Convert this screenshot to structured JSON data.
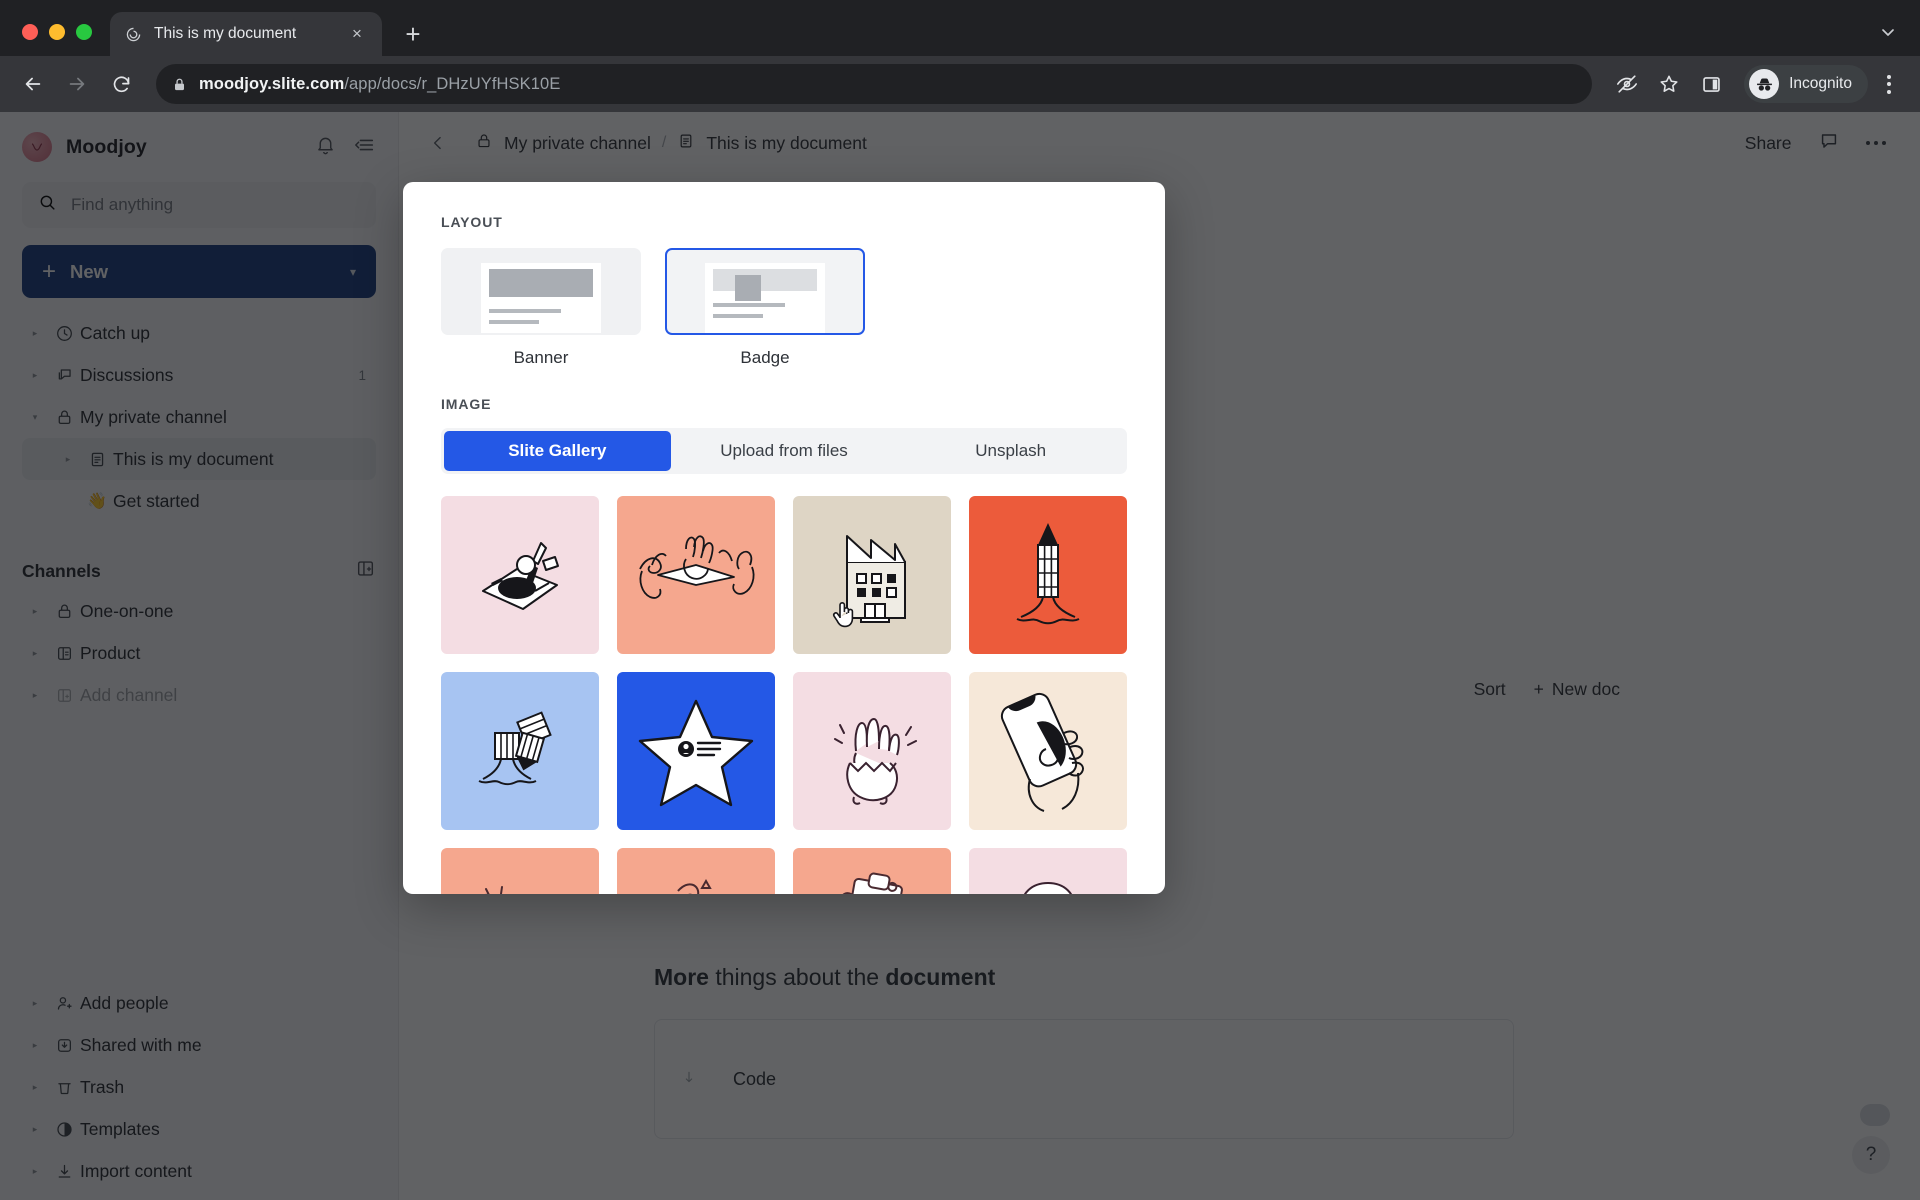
{
  "browser": {
    "tab": {
      "title": "This is my document",
      "favicon": "slite-icon",
      "close": "×"
    },
    "new_tab": "+",
    "tabstrip_chevron": "chevron-down-icon",
    "url_bold": "moodjoy.slite.com",
    "url_rest": "/app/docs/r_DHzUYfHSK10E",
    "lock": "lock-icon",
    "back": "back-arrow-icon",
    "forward": "forward-arrow-icon",
    "reload": "reload-icon",
    "icons": {
      "tracking": "eye-off-icon",
      "bookmark": "star-icon",
      "sidepanel": "side-panel-icon"
    },
    "profile_label": "Incognito",
    "menu": "kebab-menu-icon"
  },
  "sidebar": {
    "workspace": "Moodjoy",
    "notifications_icon": "bell-icon",
    "collapse_icon": "collapse-sidebar-icon",
    "search_placeholder": "Find anything",
    "new_button": {
      "label": "New",
      "plus": "+",
      "caret": "▾"
    },
    "nav": [
      {
        "label": "Catch up",
        "icon": "clock-icon",
        "badge": "",
        "indent": false,
        "selected": false,
        "ghost": false
      },
      {
        "label": "Discussions",
        "icon": "chat-icon",
        "badge": "1",
        "indent": false,
        "selected": false,
        "ghost": false
      },
      {
        "label": "My private channel",
        "icon": "lock-icon",
        "badge": "",
        "indent": false,
        "selected": false,
        "ghost": false,
        "expanded": true
      },
      {
        "label": "This is my document",
        "icon": "doc-icon",
        "badge": "",
        "indent": true,
        "selected": true,
        "ghost": false
      },
      {
        "label": "Get started",
        "icon": "wave-emoji",
        "badge": "",
        "indent": true,
        "selected": false,
        "ghost": false
      }
    ],
    "channels_title": "Channels",
    "channels_action_icon": "add-channel-icon",
    "channels": [
      {
        "label": "One-on-one",
        "icon": "lock-icon",
        "ghost": false
      },
      {
        "label": "Product",
        "icon": "channel-icon",
        "ghost": false
      },
      {
        "label": "Add channel",
        "icon": "add-channel-icon",
        "ghost": true
      }
    ],
    "bottom": [
      {
        "label": "Add people",
        "icon": "add-person-icon",
        "ghost": false
      },
      {
        "label": "Shared with me",
        "icon": "shared-inbox-icon",
        "ghost": false
      },
      {
        "label": "Trash",
        "icon": "trash-icon",
        "ghost": false
      },
      {
        "label": "Templates",
        "icon": "templates-icon",
        "ghost": false
      },
      {
        "label": "Import content",
        "icon": "import-icon",
        "ghost": false
      }
    ]
  },
  "doc": {
    "collapse_icon": "collapse-icon",
    "back_icon": "chevron-left-icon",
    "forward_icon": "chevron-right-icon",
    "breadcrumb": [
      {
        "label": "My private channel",
        "icon": "lock-icon"
      },
      {
        "label": "This is my document",
        "icon": "doc-icon"
      }
    ],
    "separator": "/",
    "share_label": "Share",
    "comment_icon": "comment-icon",
    "more_icon": "more-horizontal-icon",
    "sort_label": "Sort",
    "new_doc_label": "New doc",
    "new_doc_plus": "+",
    "heading_bold": "More",
    "heading_rest": " things about the ",
    "heading_bold2": "document",
    "code_label": "Code",
    "code_handle": "drag-handle-icon",
    "help_label": "?"
  },
  "modal": {
    "layout_section": "LAYOUT",
    "layouts": [
      {
        "name": "Banner",
        "selected": false
      },
      {
        "name": "Badge",
        "selected": true
      }
    ],
    "image_section": "IMAGE",
    "tabs": [
      {
        "label": "Slite Gallery",
        "active": true
      },
      {
        "label": "Upload from files",
        "active": false
      },
      {
        "label": "Unsplash",
        "active": false
      }
    ],
    "accent_color": "#2458e6",
    "gallery": [
      {
        "name": "desk-with-papers",
        "bg": "#f4dde3",
        "art": "desk"
      },
      {
        "name": "hands-holding-paper",
        "bg": "#f5a78e",
        "art": "hands-paper"
      },
      {
        "name": "factory-building",
        "bg": "#ded5c5",
        "art": "factory",
        "cursor": true
      },
      {
        "name": "pencil-rocket",
        "bg": "#ec5b3b",
        "art": "rocket-pencil"
      },
      {
        "name": "launching-notes",
        "bg": "#a7c4f2",
        "art": "notes-launch"
      },
      {
        "name": "star-profile",
        "bg": "#2458e6",
        "art": "star"
      },
      {
        "name": "hand-in-eggshell",
        "bg": "#f4dde3",
        "art": "egg-hand"
      },
      {
        "name": "hand-holding-phone",
        "bg": "#f6e8d9",
        "art": "phone-hand"
      },
      {
        "name": "hand-plugging-cable",
        "bg": "#f5a78e",
        "art": "plug"
      },
      {
        "name": "hands-confetti",
        "bg": "#f5a78e",
        "art": "confetti"
      },
      {
        "name": "clipboard-pencil",
        "bg": "#f5a78e",
        "art": "clipboard"
      },
      {
        "name": "face-thinking",
        "bg": "#f4dde3",
        "art": "face"
      }
    ]
  }
}
